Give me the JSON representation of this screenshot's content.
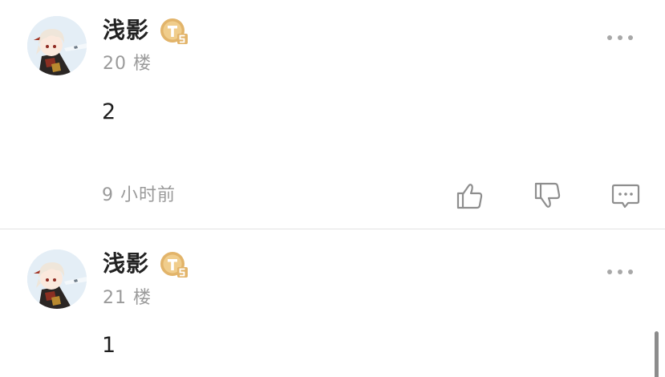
{
  "colors": {
    "username": "#222222",
    "secondary_text": "#9a9a9a",
    "badge_gold": "#e2b46a",
    "icon_stroke": "#8e8e8e",
    "divider": "#e3e3e3"
  },
  "posts": [
    {
      "username": "浅影",
      "badge_icon": "level-badge-icon",
      "floor": "20 楼",
      "content": "2",
      "time": "9 小时前",
      "actions": [
        "thumbs-up-icon",
        "thumbs-down-icon",
        "comment-icon"
      ]
    },
    {
      "username": "浅影",
      "badge_icon": "level-badge-icon",
      "floor": "21 楼",
      "content": "1"
    }
  ]
}
